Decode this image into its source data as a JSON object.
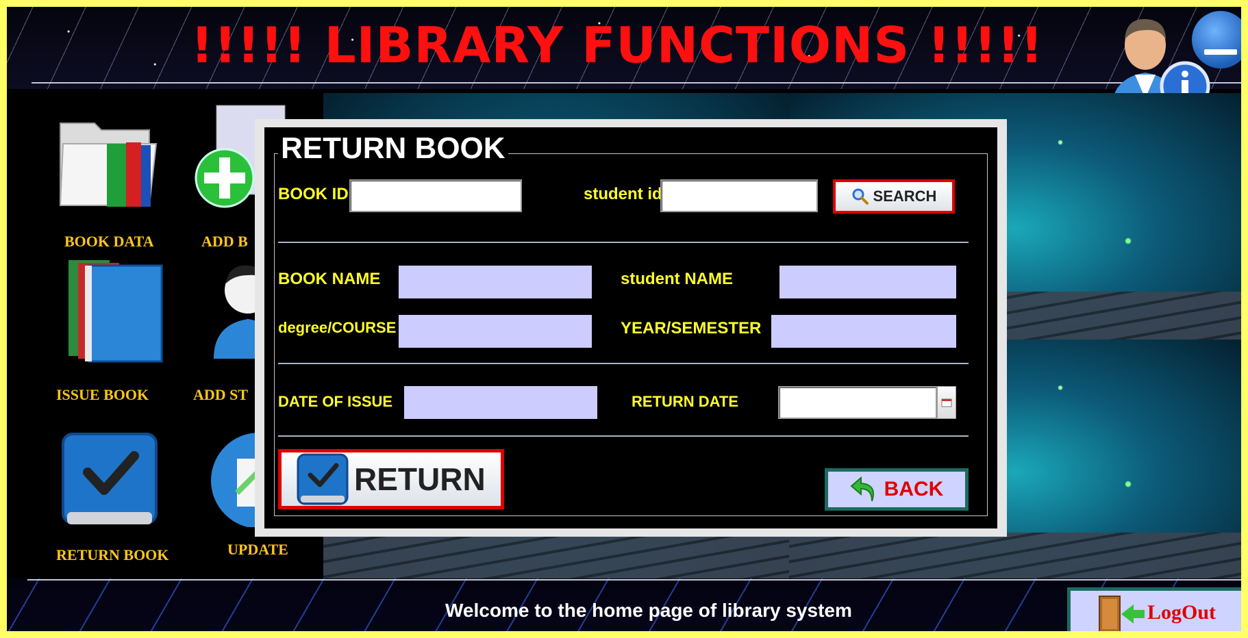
{
  "header": {
    "title": "!!!!! LIBRARY  FUNCTIONS !!!!!"
  },
  "menu": {
    "book_data": "BOOK DATA",
    "add_book": "ADD B",
    "issue_book": "ISSUE BOOK",
    "add_student": "ADD ST",
    "return_book": "RETURN BOOK",
    "update": "UPDATE"
  },
  "dialog": {
    "title": "RETURN BOOK",
    "book_id_label": "BOOK ID",
    "book_id_value": "",
    "student_id_label": "student id",
    "student_id_value": "",
    "search_label": "SEARCH",
    "book_name_label": "BOOK NAME",
    "book_name_value": "",
    "student_name_label": "student  NAME",
    "student_name_value": "",
    "course_label": "degree/COURSE",
    "course_value": "",
    "year_label": "YEAR/SEMESTER",
    "year_value": "",
    "issue_date_label": "DATE OF ISSUE",
    "issue_date_value": "",
    "return_date_label": "RETURN DATE",
    "return_date_value": "",
    "return_label": "RETURN",
    "back_label": "BACK"
  },
  "footer": {
    "welcome": "Welcome to the home page of library system",
    "logout_label": "LogOut"
  },
  "colors": {
    "title_red": "#ff1010",
    "label_yellow": "#ffff26",
    "menu_gold": "#ffc61a",
    "field_lilac": "#ccccff",
    "border_yellow": "#ffff66",
    "accent_teal": "#1d6b60"
  },
  "icons": [
    "user-info-icon",
    "minimize-icon",
    "book-data-icon",
    "add-book-icon",
    "issue-book-icon",
    "add-student-icon",
    "return-book-icon",
    "update-icon",
    "search-icon",
    "checkmark-icon",
    "back-arrow-icon",
    "calendar-icon",
    "door-exit-icon"
  ]
}
